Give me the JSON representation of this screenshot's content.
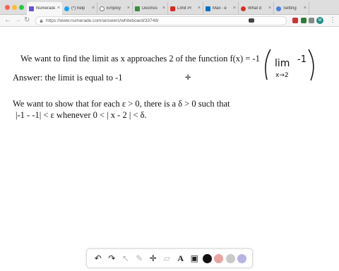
{
  "browser": {
    "tabs": [
      {
        "label": "Numerade",
        "favicon_color": "#6b4fd6",
        "active": true
      },
      {
        "label": "(*) help",
        "favicon_color": "#1da1f2",
        "active": false
      },
      {
        "label": "Employ",
        "favicon_color": "#777777",
        "active": false
      },
      {
        "label": "Desmos",
        "favicon_color": "#3a8f3a",
        "active": false
      },
      {
        "label": "Limit Pr",
        "favicon_color": "#e62117",
        "active": false
      },
      {
        "label": "Mail - e",
        "favicon_color": "#0072c6",
        "active": false
      },
      {
        "label": "What d",
        "favicon_color": "#d43127",
        "active": false
      },
      {
        "label": "Setting",
        "favicon_color": "#4a7fe0",
        "active": false
      }
    ],
    "url": "https://www.numerade.com/answers/whiteboard/33748/",
    "avatar_letter": "M",
    "accent": "#1e8e87"
  },
  "whiteboard": {
    "line1": "We want to find the limit as x approaches 2 of the function f(x) = -1",
    "handwritten": {
      "lim": "lim",
      "sub": "x→2",
      "value": "-1"
    },
    "line2": "Answer: the limit is equal to -1",
    "line3": "We want to show that for each ε > 0, there is a δ > 0 such that",
    "line4": "|-1 - -1| <  ε  whenever 0 < | x - 2 | < δ."
  },
  "draw_toolbar": {
    "tools": [
      {
        "name": "undo-icon",
        "glyph": "↶"
      },
      {
        "name": "redo-icon",
        "glyph": "↷"
      },
      {
        "name": "pointer-icon",
        "glyph": "↖"
      },
      {
        "name": "pen-icon",
        "glyph": "✎"
      },
      {
        "name": "move-icon",
        "glyph": "✛"
      },
      {
        "name": "eraser-icon",
        "glyph": "▱"
      },
      {
        "name": "text-icon",
        "glyph": "A"
      },
      {
        "name": "image-icon",
        "glyph": "▣"
      }
    ],
    "colors": [
      "#111111",
      "#e9a3a3",
      "#c9c9c9",
      "#b7b4e3"
    ]
  }
}
